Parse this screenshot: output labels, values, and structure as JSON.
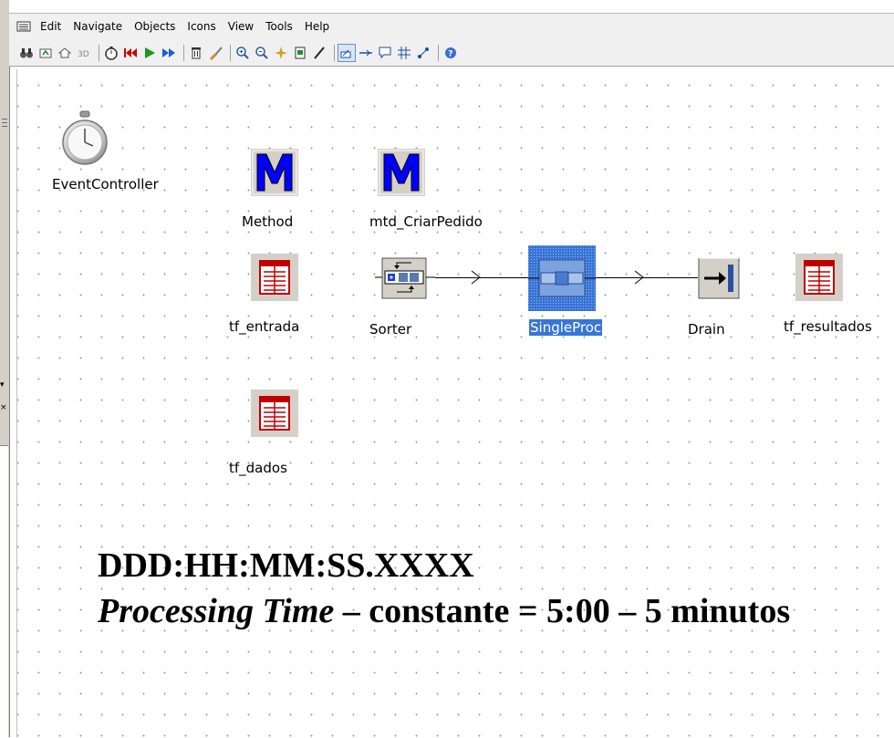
{
  "menu": {
    "items": [
      "Edit",
      "Navigate",
      "Objects",
      "Icons",
      "View",
      "Tools",
      "Help"
    ]
  },
  "toolbar": {
    "icons": [
      "binoculars-icon",
      "up-icon",
      "home-icon",
      "3d-icon",
      "stopwatch-icon",
      "reset-icon",
      "play-icon",
      "fast-forward-icon",
      "delete-icon",
      "cleanup-icon",
      "zoom-in-icon",
      "zoom-out-icon",
      "fit-icon",
      "print-icon",
      "pencil-icon",
      "connector-mode-icon",
      "connect-icon",
      "comment-icon",
      "grid-icon",
      "layout-icon",
      "help-icon"
    ]
  },
  "objects": {
    "event_controller": "EventController",
    "method": "Method",
    "mtd_criar": "mtd_CriarPedido",
    "tf_entrada": "tf_entrada",
    "sorter": "Sorter",
    "singleproc": "SingleProc",
    "drain": "Drain",
    "tf_resultados": "tf_resultados",
    "tf_dados": "tf_dados"
  },
  "annotation": {
    "line1": "DDD:HH:MM:SS.XXXX",
    "line2_italic": "Processing Time",
    "line2_rest": " – constante = 5:00 – 5 minutos"
  },
  "colors": {
    "method_blue": "#0000ff",
    "selection": "#3875d7",
    "table_red": "#c00000"
  }
}
